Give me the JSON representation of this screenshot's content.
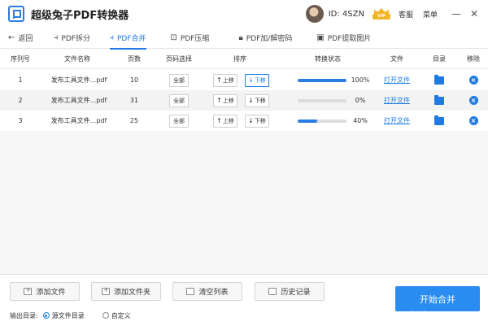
{
  "app": {
    "title": "超级兔子PDF转换器"
  },
  "user": {
    "id_label": "ID: 4SZN",
    "vip": "VIP"
  },
  "top_links": {
    "service": "客服",
    "menu": "菜单"
  },
  "window": {
    "minimize": "—",
    "close": "✕"
  },
  "toolbar": {
    "back": "返回",
    "tabs": [
      {
        "label": "PDF拆分",
        "active": false
      },
      {
        "label": "PDF合并",
        "active": true
      },
      {
        "label": "PDF压缩",
        "active": false
      },
      {
        "label": "PDF加/解密码",
        "active": false
      },
      {
        "label": "PDF提取图片",
        "active": false
      }
    ]
  },
  "table": {
    "headers": {
      "index": "序列号",
      "name": "文件名称",
      "pages": "页数",
      "page_select": "页码选择",
      "sort": "排序",
      "status": "转换状态",
      "file": "文件",
      "dir": "目录",
      "remove": "移除"
    },
    "rows": [
      {
        "index": "1",
        "name": "发布工具文件...pdf",
        "pages": "10",
        "page_select": "全部",
        "up": "上移",
        "down": "下移",
        "progress": 100,
        "progress_label": "100%",
        "open": "打开文件"
      },
      {
        "index": "2",
        "name": "发布工具文件...pdf",
        "pages": "31",
        "page_select": "全部",
        "up": "上移",
        "down": "下移",
        "progress": 0,
        "progress_label": "0%",
        "open": "打开文件"
      },
      {
        "index": "3",
        "name": "发布工具文件...pdf",
        "pages": "25",
        "page_select": "全部",
        "up": "上移",
        "down": "下移",
        "progress": 40,
        "progress_label": "40%",
        "open": "打开文件"
      }
    ]
  },
  "bottom": {
    "add_file": "添加文件",
    "add_folder": "添加文件夹",
    "clear_list": "清空列表",
    "history": "历史记录",
    "start": "开始合并",
    "output_label": "输出目录:",
    "option_source": "源文件目录",
    "option_custom": "自定义"
  },
  "watermark": "当游网"
}
